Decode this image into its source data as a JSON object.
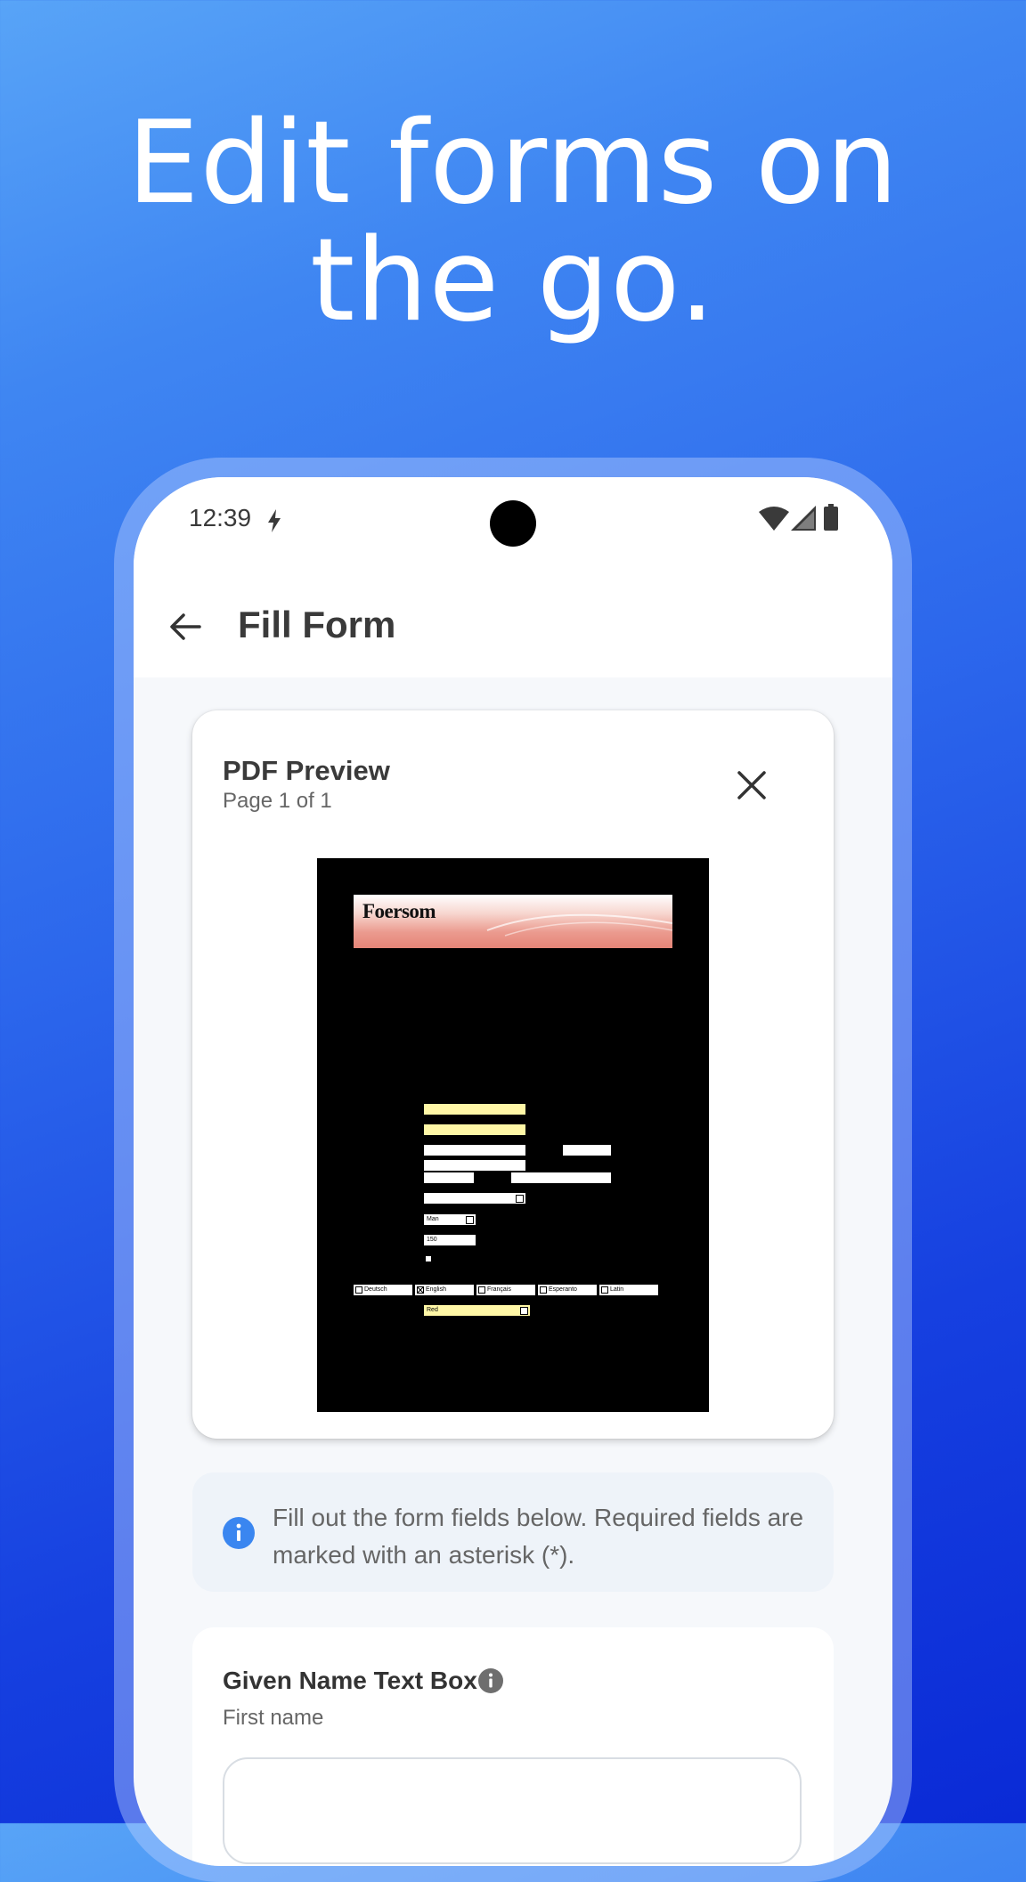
{
  "headline": {
    "line1": "Edit forms on",
    "line2": "the go."
  },
  "status_bar": {
    "time": "12:39"
  },
  "app_bar": {
    "title": "Fill Form"
  },
  "preview": {
    "title": "PDF Preview",
    "page_info": "Page 1 of 1",
    "pdf": {
      "logo_text": "Foersom",
      "dropdown_height": "Man",
      "height_value": "150",
      "languages": [
        "Deutsch",
        "English",
        "Français",
        "Esperanto",
        "Latin"
      ],
      "checked_language": "English",
      "color_value": "Red"
    }
  },
  "info": {
    "text": "Fill out the form fields below. Required fields are marked with an asterisk (*)."
  },
  "field": {
    "label": "Given Name Text Box",
    "hint": "First name",
    "value": ""
  },
  "colors": {
    "accent": "#3a86f0",
    "pdf_field_yellow": "#fff7a6"
  }
}
